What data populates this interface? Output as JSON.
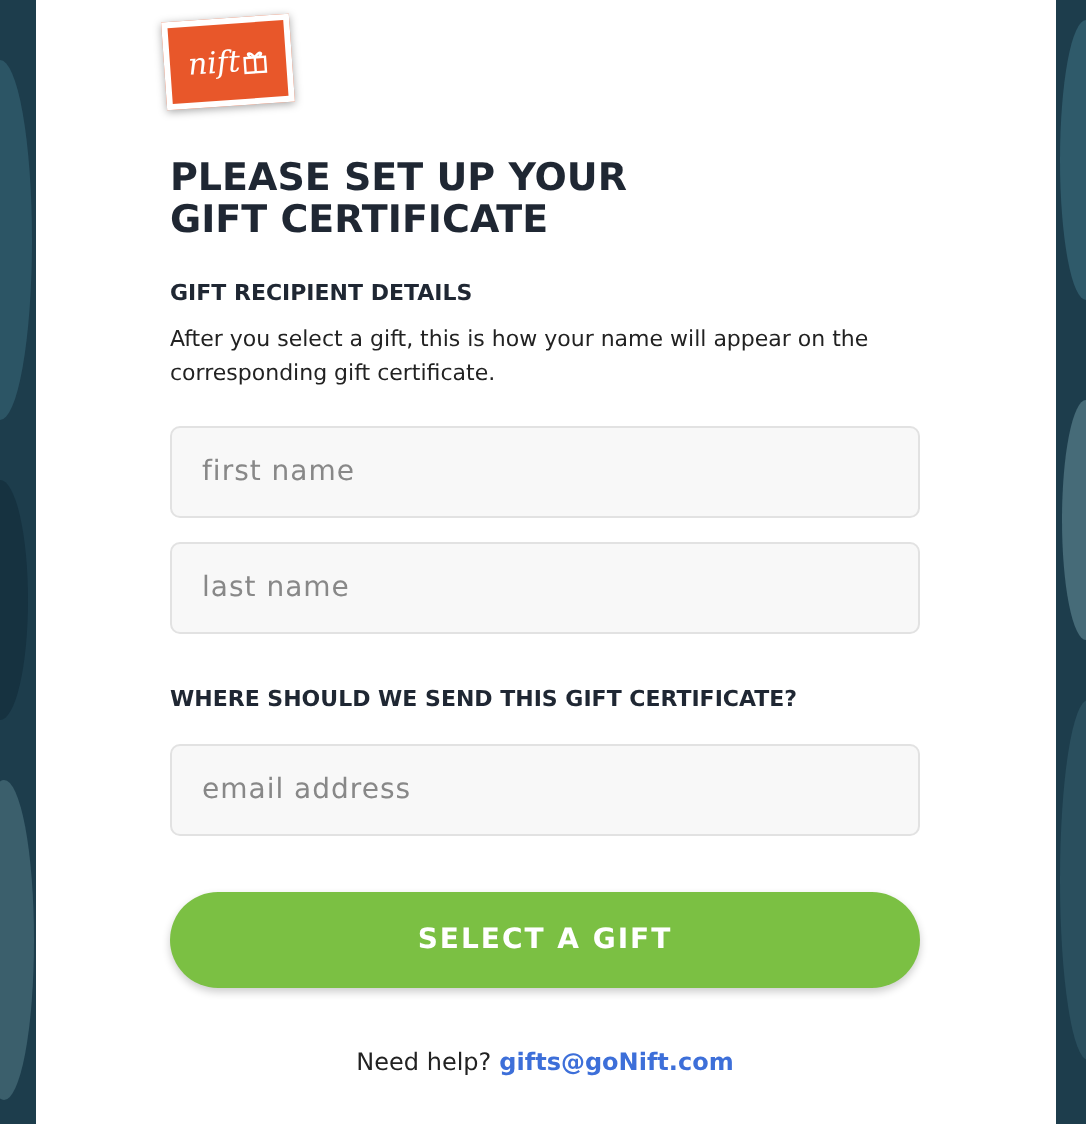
{
  "logo": {
    "text": "nift"
  },
  "heading": [
    "PLEASE SET UP YOUR",
    "GIFT CERTIFICATE"
  ],
  "recipient_section": {
    "title": "GIFT RECIPIENT DETAILS",
    "description": "After you select a gift, this is how your name will appear on the corresponding gift certificate.",
    "fields": [
      {
        "placeholder": "first name"
      },
      {
        "placeholder": "last name"
      }
    ]
  },
  "delivery_section": {
    "title": "WHERE SHOULD WE SEND THIS GIFT CERTIFICATE?",
    "fields": [
      {
        "placeholder": "email address"
      }
    ]
  },
  "submit_button": "SELECT A GIFT",
  "help": {
    "text": "Need help?",
    "link": "gifts@goNift.com"
  }
}
